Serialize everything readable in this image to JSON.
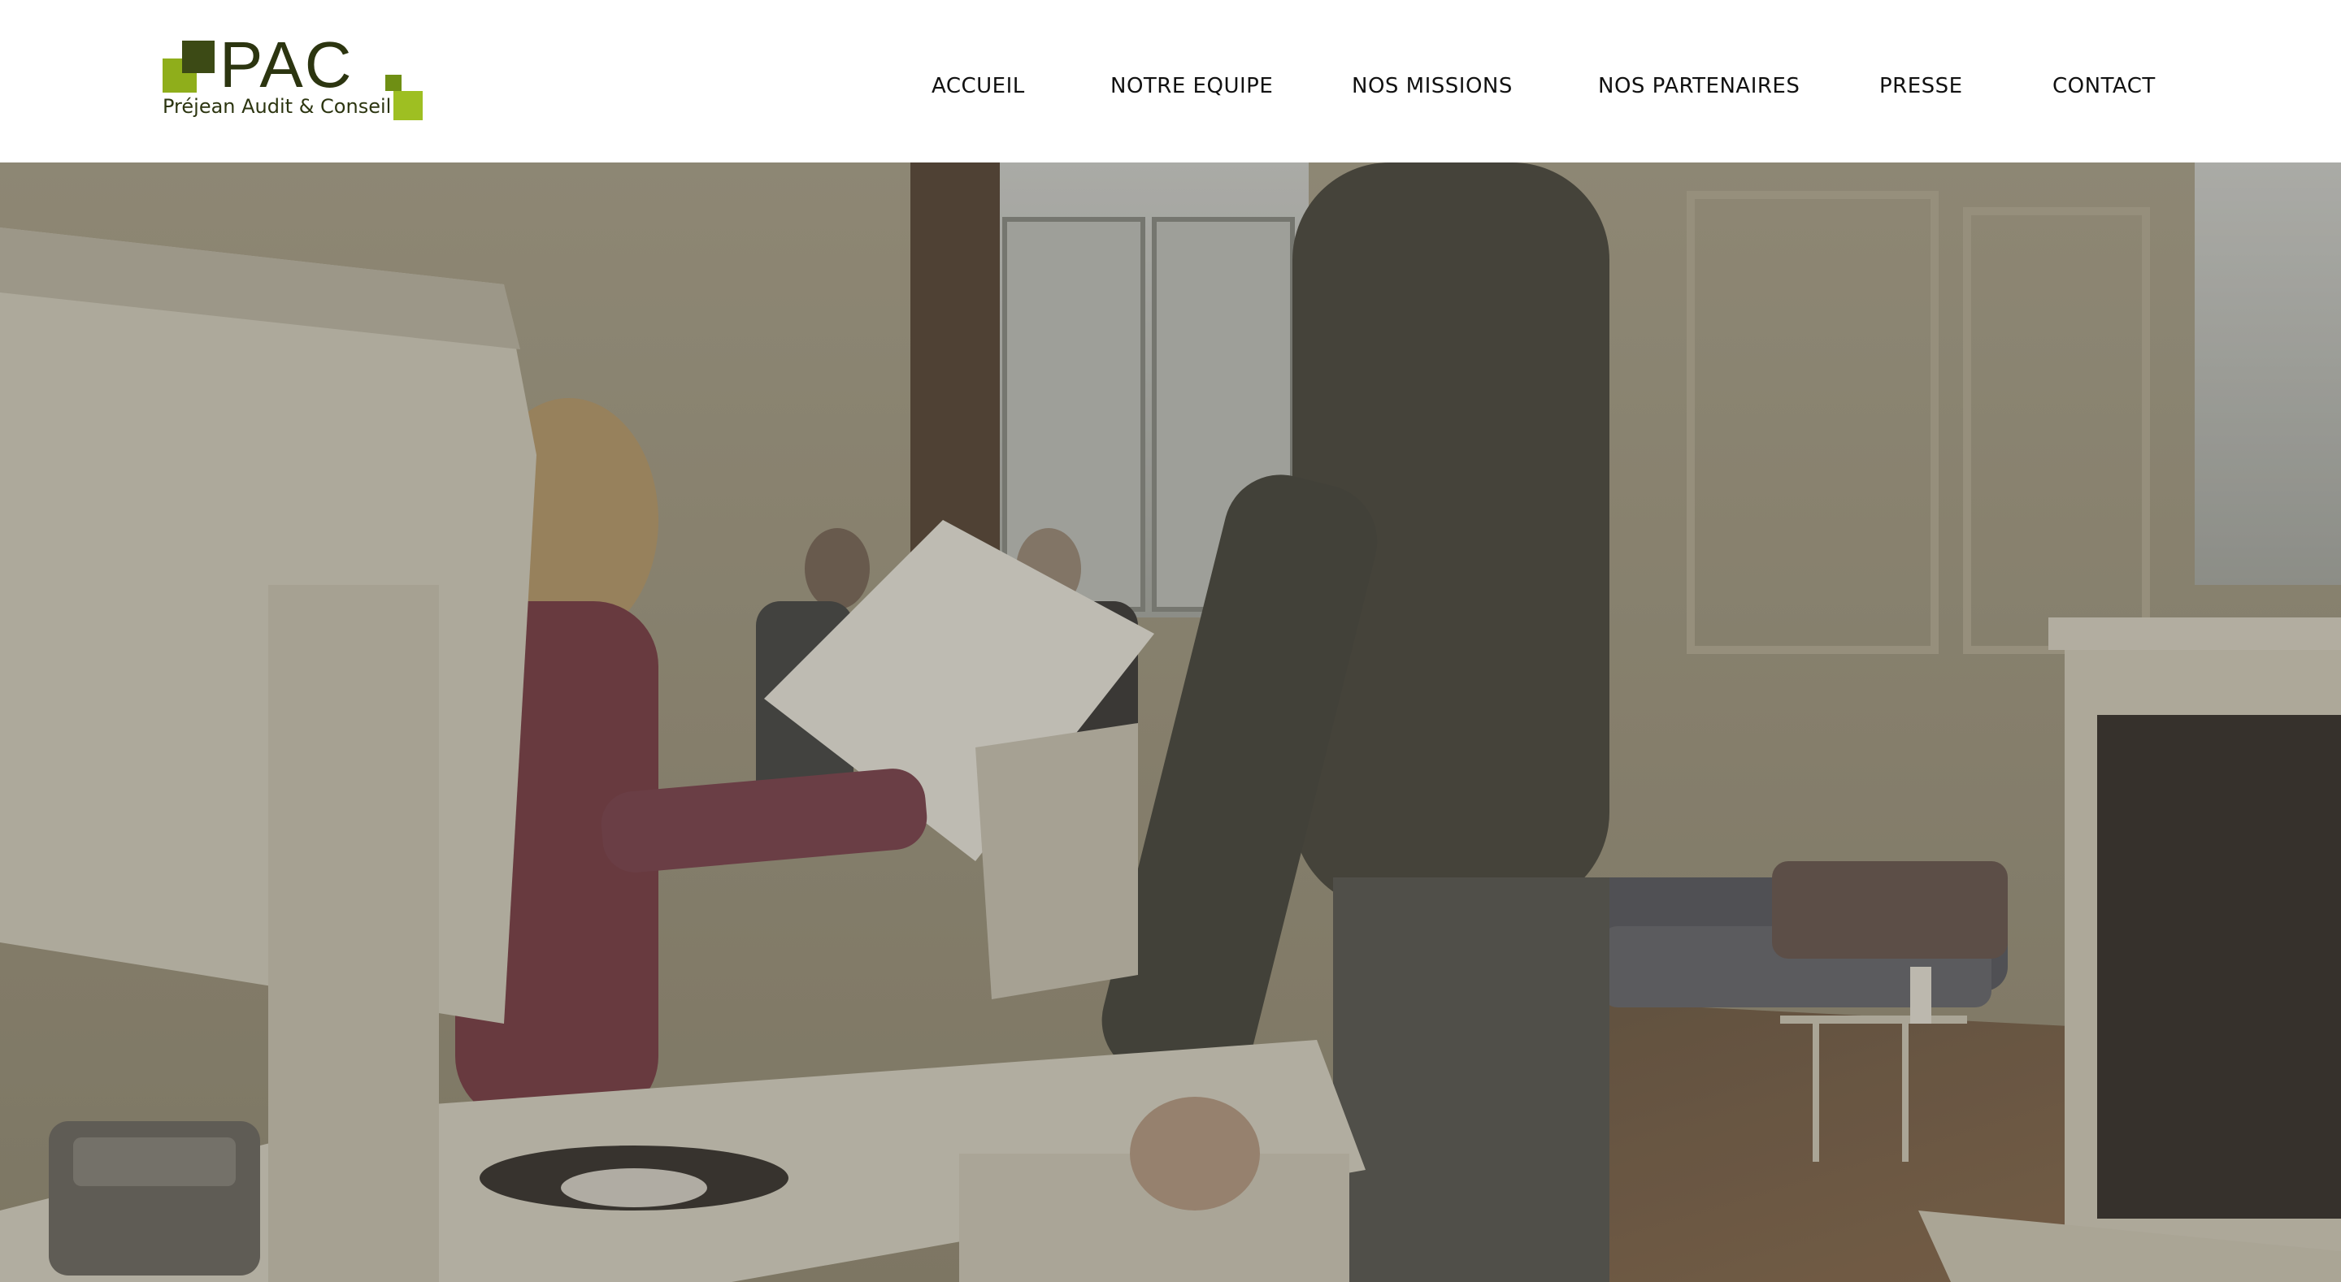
{
  "site": {
    "logo": {
      "brand": "PAC",
      "tagline": "Préjean Audit & Conseil",
      "colors": {
        "dark": "#3c4a15",
        "light": "#8fae1b"
      }
    },
    "nav": {
      "items": [
        {
          "label": "ACCUEIL"
        },
        {
          "label": "NOTRE EQUIPE"
        },
        {
          "label": "NOS MISSIONS"
        },
        {
          "label": "NOS PARTENAIRES"
        },
        {
          "label": "PRESSE"
        },
        {
          "label": "CONTACT"
        }
      ]
    }
  },
  "hero": {
    "type": "background-video",
    "image_subject": "office-scene",
    "palette": {
      "wall": "#a39d87",
      "floor": "#7b6650",
      "desk": "#d8d4c4"
    }
  }
}
